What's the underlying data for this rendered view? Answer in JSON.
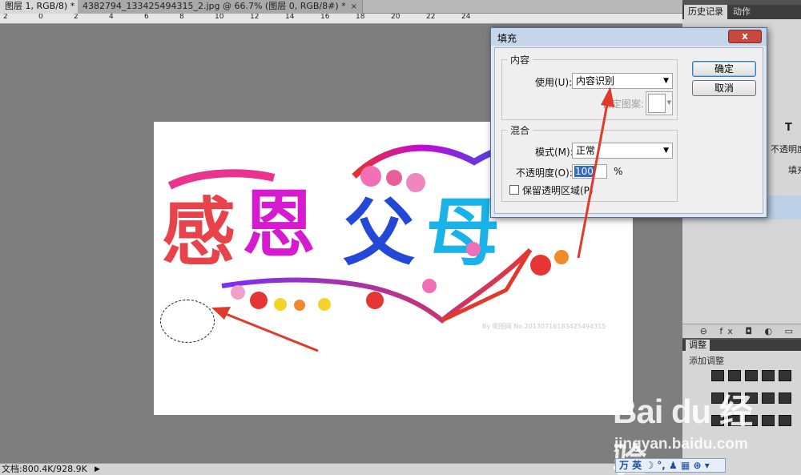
{
  "tabs": [
    {
      "label": "图层 1, RGB/8) *",
      "close": "×"
    },
    {
      "label": "4382794_133425494315_2.jpg @ 66.7% (图层 0, RGB/8#) *",
      "close": "×"
    }
  ],
  "ruler_numbers": [
    "2",
    "0",
    "2",
    "4",
    "6",
    "8",
    "10",
    "12",
    "14",
    "16",
    "18",
    "20",
    "22",
    "24"
  ],
  "artwork": {
    "chars": [
      "感",
      "恩",
      "父",
      "母"
    ],
    "watermark": "By 昵图网 No.20130716183425494315"
  },
  "statusbar": {
    "text": "文档:800.4K/928.9K",
    "arrow": "▶"
  },
  "right_panel": {
    "tab_history": "历史记录",
    "tab_actions": "动作",
    "tool_t": "T",
    "row_opacity": "不透明度",
    "row_fill": "填充",
    "bottom_icons": "⊖ fx ◘ ◐ ▭",
    "adjust_tab": "调整",
    "adjust_title": "添加调整"
  },
  "dialog": {
    "title": "填充",
    "close": "x",
    "content_group": "内容",
    "use_label": "使用(U):",
    "use_value": "内容识别",
    "pattern_label": "自定图案:",
    "blend_group": "混合",
    "mode_label": "模式(M):",
    "mode_value": "正常",
    "opacity_label": "不透明度(O):",
    "opacity_value": "100",
    "opacity_unit": "%",
    "preserve_label": "保留透明区域(P)",
    "ok": "确定",
    "cancel": "取消"
  },
  "watermark": {
    "logo": "Bai du 经验",
    "url": "jingyan.baidu.com"
  },
  "ime": {
    "text": "万 英 ☽ °, ♟ ▦ ⊛ ▾"
  },
  "colors": {
    "dialog_bg": "#efefef",
    "titlebar": "#c5d6ea",
    "close_btn": "#c8483d",
    "selection": "#316ac5",
    "arrow": "#e03a2a"
  }
}
